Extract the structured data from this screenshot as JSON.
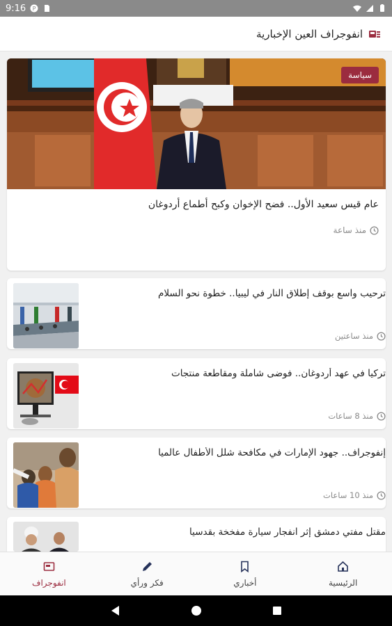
{
  "status_bar": {
    "time": "9:16"
  },
  "app_bar": {
    "title": "انفوجراف العين الإخبارية",
    "accent": "#9b2c3f"
  },
  "featured": {
    "category": "سياسة",
    "title": "عام قيس سعيد الأول.. فضح الإخوان وكبح أطماع أردوغان",
    "time": "منذ ساعة"
  },
  "articles": [
    {
      "title": "ترحيب واسع بوقف إطلاق النار في ليبيا.. خطوة نحو السلام",
      "time": "منذ ساعتين"
    },
    {
      "title": "تركيا في عهد أردوغان.. فوضى شاملة ومقاطعة منتجات",
      "time": "منذ 8 ساعات"
    },
    {
      "title": "إنفوجراف.. جهود الإمارات في مكافحة شلل الأطفال عالميا",
      "time": "منذ 10 ساعات"
    },
    {
      "title": "مقتل مفتي دمشق إثر انفجار سيارة مفخخة بقدسيا",
      "time": ""
    }
  ],
  "bottom_nav": {
    "home": "الرئيسية",
    "news": "أخباري",
    "opinion": "فكر ورأي",
    "infographic": "انفوجراف"
  }
}
